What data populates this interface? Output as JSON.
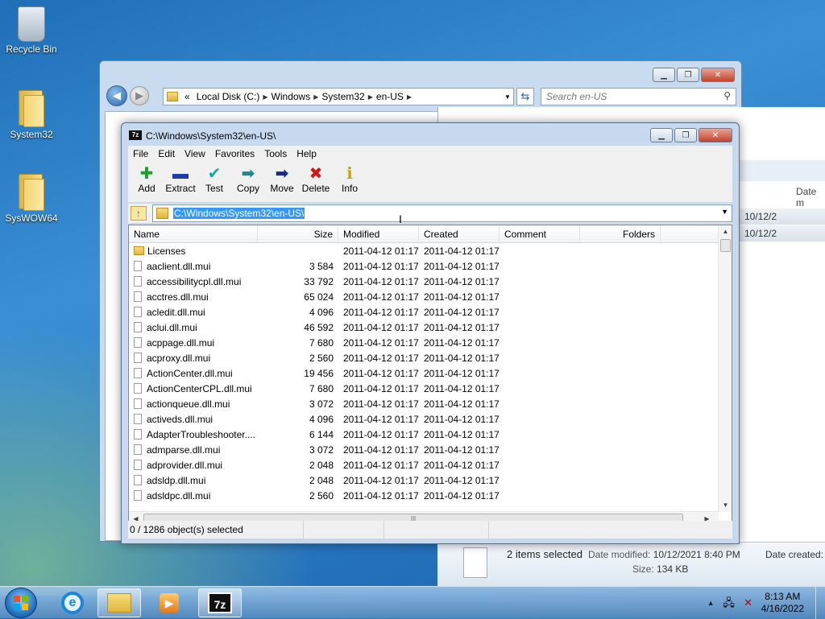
{
  "desktop": {
    "icons": [
      {
        "label": "Recycle Bin"
      },
      {
        "label": "System32"
      },
      {
        "label": "SysWOW64"
      }
    ]
  },
  "explorer": {
    "breadcrumb": [
      "«",
      "Local Disk (C:)",
      "Windows",
      "System32",
      "en-US"
    ],
    "search_placeholder": "Search en-US",
    "column_header": "Date m",
    "rows": [
      "10/12/2",
      "10/12/2"
    ],
    "details": {
      "selection": "2 items selected",
      "date_modified_label": "Date modified:",
      "date_modified": "10/12/2021 8:40 PM",
      "date_created_label": "Date created:",
      "size_label": "Size:",
      "size": "134 KB"
    }
  },
  "sevenzip": {
    "app_icon": "7z",
    "title": "C:\\Windows\\System32\\en-US\\",
    "menu": [
      "File",
      "Edit",
      "View",
      "Favorites",
      "Tools",
      "Help"
    ],
    "toolbar": [
      {
        "label": "Add",
        "icon": "plus-icon",
        "glyph": "✚",
        "color": "#1e9e2e"
      },
      {
        "label": "Extract",
        "icon": "minus-icon",
        "glyph": "▬",
        "color": "#1a3fa8"
      },
      {
        "label": "Test",
        "icon": "check-icon",
        "glyph": "✔",
        "color": "#19a6a6"
      },
      {
        "label": "Copy",
        "icon": "copy-arrow-icon",
        "glyph": "➡",
        "color": "#1a8a8a"
      },
      {
        "label": "Move",
        "icon": "move-arrow-icon",
        "glyph": "➡",
        "color": "#1a2c8a"
      },
      {
        "label": "Delete",
        "icon": "delete-icon",
        "glyph": "✖",
        "color": "#d01818"
      },
      {
        "label": "Info",
        "icon": "info-icon",
        "glyph": "ℹ",
        "color": "#c9a400"
      }
    ],
    "path": "C:\\Windows\\System32\\en-US\\",
    "columns": {
      "name": "Name",
      "size": "Size",
      "modified": "Modified",
      "created": "Created",
      "comment": "Comment",
      "folders": "Folders"
    },
    "files": [
      {
        "name": "Licenses",
        "size": "",
        "modified": "2011-04-12 01:17",
        "created": "2011-04-12 01:17",
        "folder": true
      },
      {
        "name": "aaclient.dll.mui",
        "size": "3 584",
        "modified": "2011-04-12 01:17",
        "created": "2011-04-12 01:17"
      },
      {
        "name": "accessibilitycpl.dll.mui",
        "size": "33 792",
        "modified": "2011-04-12 01:17",
        "created": "2011-04-12 01:17"
      },
      {
        "name": "acctres.dll.mui",
        "size": "65 024",
        "modified": "2011-04-12 01:17",
        "created": "2011-04-12 01:17"
      },
      {
        "name": "acledit.dll.mui",
        "size": "4 096",
        "modified": "2011-04-12 01:17",
        "created": "2011-04-12 01:17"
      },
      {
        "name": "aclui.dll.mui",
        "size": "46 592",
        "modified": "2011-04-12 01:17",
        "created": "2011-04-12 01:17"
      },
      {
        "name": "acppage.dll.mui",
        "size": "7 680",
        "modified": "2011-04-12 01:17",
        "created": "2011-04-12 01:17"
      },
      {
        "name": "acproxy.dll.mui",
        "size": "2 560",
        "modified": "2011-04-12 01:17",
        "created": "2011-04-12 01:17"
      },
      {
        "name": "ActionCenter.dll.mui",
        "size": "19 456",
        "modified": "2011-04-12 01:17",
        "created": "2011-04-12 01:17"
      },
      {
        "name": "ActionCenterCPL.dll.mui",
        "size": "7 680",
        "modified": "2011-04-12 01:17",
        "created": "2011-04-12 01:17"
      },
      {
        "name": "actionqueue.dll.mui",
        "size": "3 072",
        "modified": "2011-04-12 01:17",
        "created": "2011-04-12 01:17"
      },
      {
        "name": "activeds.dll.mui",
        "size": "4 096",
        "modified": "2011-04-12 01:17",
        "created": "2011-04-12 01:17"
      },
      {
        "name": "AdapterTroubleshooter....",
        "size": "6 144",
        "modified": "2011-04-12 01:17",
        "created": "2011-04-12 01:17"
      },
      {
        "name": "admparse.dll.mui",
        "size": "3 072",
        "modified": "2011-04-12 01:17",
        "created": "2011-04-12 01:17"
      },
      {
        "name": "adprovider.dll.mui",
        "size": "2 048",
        "modified": "2011-04-12 01:17",
        "created": "2011-04-12 01:17"
      },
      {
        "name": "adsldp.dll.mui",
        "size": "2 048",
        "modified": "2011-04-12 01:17",
        "created": "2011-04-12 01:17"
      },
      {
        "name": "adsldpc.dll.mui",
        "size": "2 560",
        "modified": "2011-04-12 01:17",
        "created": "2011-04-12 01:17"
      }
    ],
    "status": "0 / 1286 object(s) selected"
  },
  "taskbar": {
    "time": "8:13 AM",
    "date": "4/16/2022",
    "sevenzip_label": "7z",
    "ie_glyph": "e"
  }
}
